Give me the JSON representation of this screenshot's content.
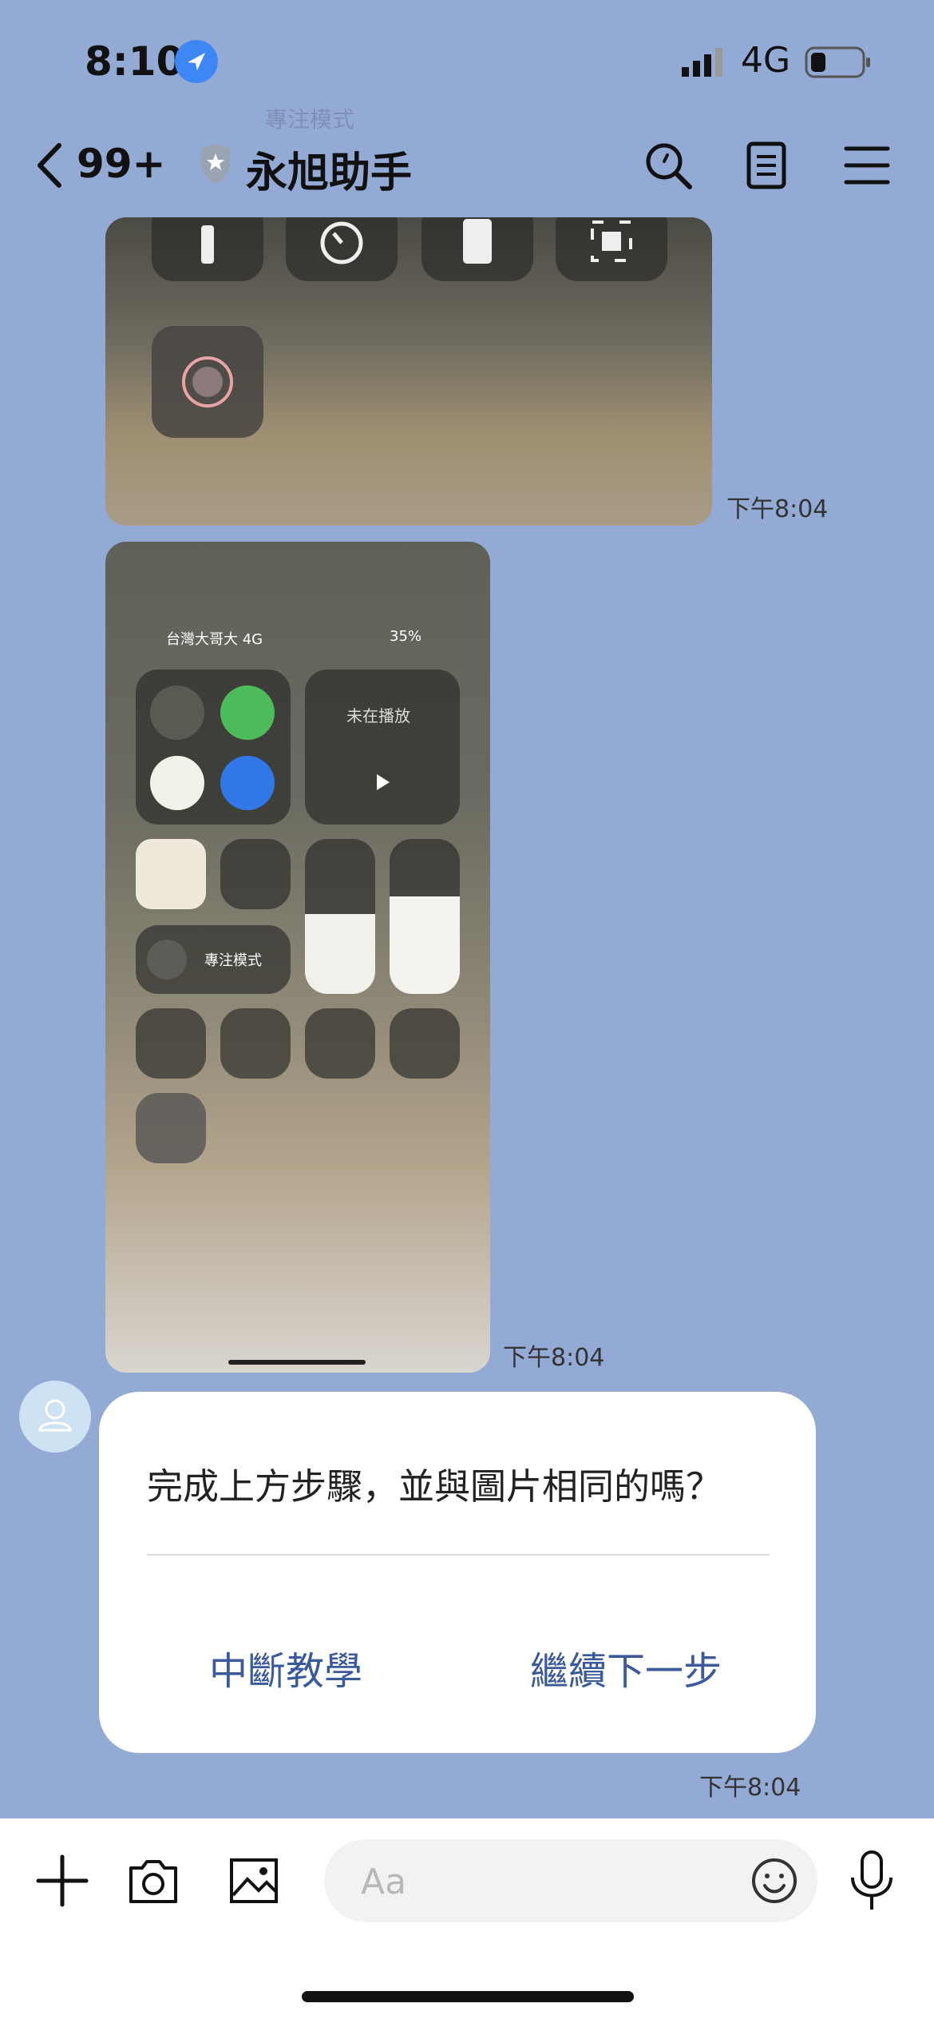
{
  "status_bar": {
    "time": "8:10",
    "network": "4G"
  },
  "header": {
    "unread_count": "99+",
    "title": "永旭助手"
  },
  "messages": {
    "image1_time": "下午8:04",
    "image2_time": "下午8:04",
    "card_time": "下午8:04"
  },
  "screenshot": {
    "carrier": "台灣大哥大 4G",
    "battery": "35%",
    "now_playing": "未在播放",
    "focus_mode": "專注模式",
    "top_focus_label": "專注模式"
  },
  "card": {
    "question": "完成上方步驟，並與圖片相同的嗎？",
    "button_stop": "中斷教學",
    "button_next": "繼續下一步"
  },
  "input": {
    "placeholder": "Aa"
  },
  "colors": {
    "background": "#93aad5",
    "accent": "#3a5a9c",
    "location": "#3d86f5"
  }
}
